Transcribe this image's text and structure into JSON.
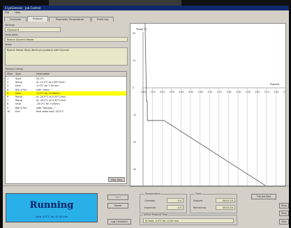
{
  "window": {
    "title": "CryoGenesis - Job Control"
  },
  "menu": [
    "File",
    "Help"
  ],
  "tabs": [
    "Overview",
    "Protocol",
    "Parameter Temperature",
    "Event Log"
  ],
  "settings": {
    "label": "Settings",
    "value": "Glycerol 8"
  },
  "description": {
    "label": "Description",
    "value": "Bovine Glycerol freeze"
  },
  "notes": {
    "label": "Notes",
    "value": "Bovine freeze (Kan) (Berlinyo) protocol with Glycerol"
  },
  "protocol": {
    "label": "Protocol Listing",
    "columns": [
      "Step",
      "Type",
      "Description"
    ],
    "rows": [
      {
        "step": "1",
        "type": "Start",
        "desc": "20.0°C"
      },
      {
        "step": "2",
        "type": "Ramp",
        "desc": "to +5.0°C at 0.80°C/min"
      },
      {
        "step": "3",
        "type": "Hold",
        "desc": "-5.0°C for 1.00 min"
      },
      {
        "step": "4",
        "type": "Bell & Pro",
        "desc": "with \"seed...\""
      },
      {
        "step": "5",
        "type": "Hold",
        "desc": "-5.0°C for 10.00min"
      },
      {
        "step": "6",
        "type": "Ramp",
        "desc": "to -20.0°C at 0.50°C/min"
      },
      {
        "step": "7",
        "type": "Ramp",
        "desc": "to -33.0°C at 0.30°C/min"
      },
      {
        "step": "8",
        "type": "Hold",
        "desc": "-33.0°C for 5.00min"
      },
      {
        "step": "9",
        "type": "Bell & Pro",
        "desc": "with \"storage...\""
      },
      {
        "step": "10",
        "type": "End",
        "desc": "final state hold -33.0°C"
      }
    ],
    "highlighted_index": 4,
    "view_btn": "View Step"
  },
  "chart": {
    "y_label": "Temp(°C)",
    "x_label": "Elapsed",
    "x_ticks": [
      "0:00",
      "0:10",
      "0:20",
      "0:30",
      "0:40",
      "0:50",
      "1:00",
      "1:10",
      "1:20",
      "1:30",
      "1:40",
      "1:50",
      "2:00",
      "2:10",
      "2:20",
      "2:30"
    ],
    "y_ticks": [
      "20",
      "10",
      "0",
      "-10",
      "-20",
      "-30"
    ]
  },
  "status": {
    "title": "Running",
    "sub": "Hold -5.0°C for 12.00 min"
  },
  "controls": {
    "start": "Start",
    "pause": "Pause",
    "log": "Log Comment"
  },
  "temperature": {
    "label": "Temperature",
    "chamber_label": "Chamber",
    "chamber_value": "-5.0",
    "expected_label": "Expected",
    "expected_value": "-5.0"
  },
  "time": {
    "label": "Time",
    "elapsed_label": "Elapsed",
    "elapsed_value": "00:01:23",
    "remaining_label": "Remaining",
    "remaining_value": "00:52:24"
  },
  "active_step": {
    "label": "Active Protocol Step",
    "value": "5) Hold -5.0°C for 12.00 min"
  },
  "side_buttons": [
    "Tile Job Sets",
    "Step",
    "Step",
    "Skip"
  ]
}
